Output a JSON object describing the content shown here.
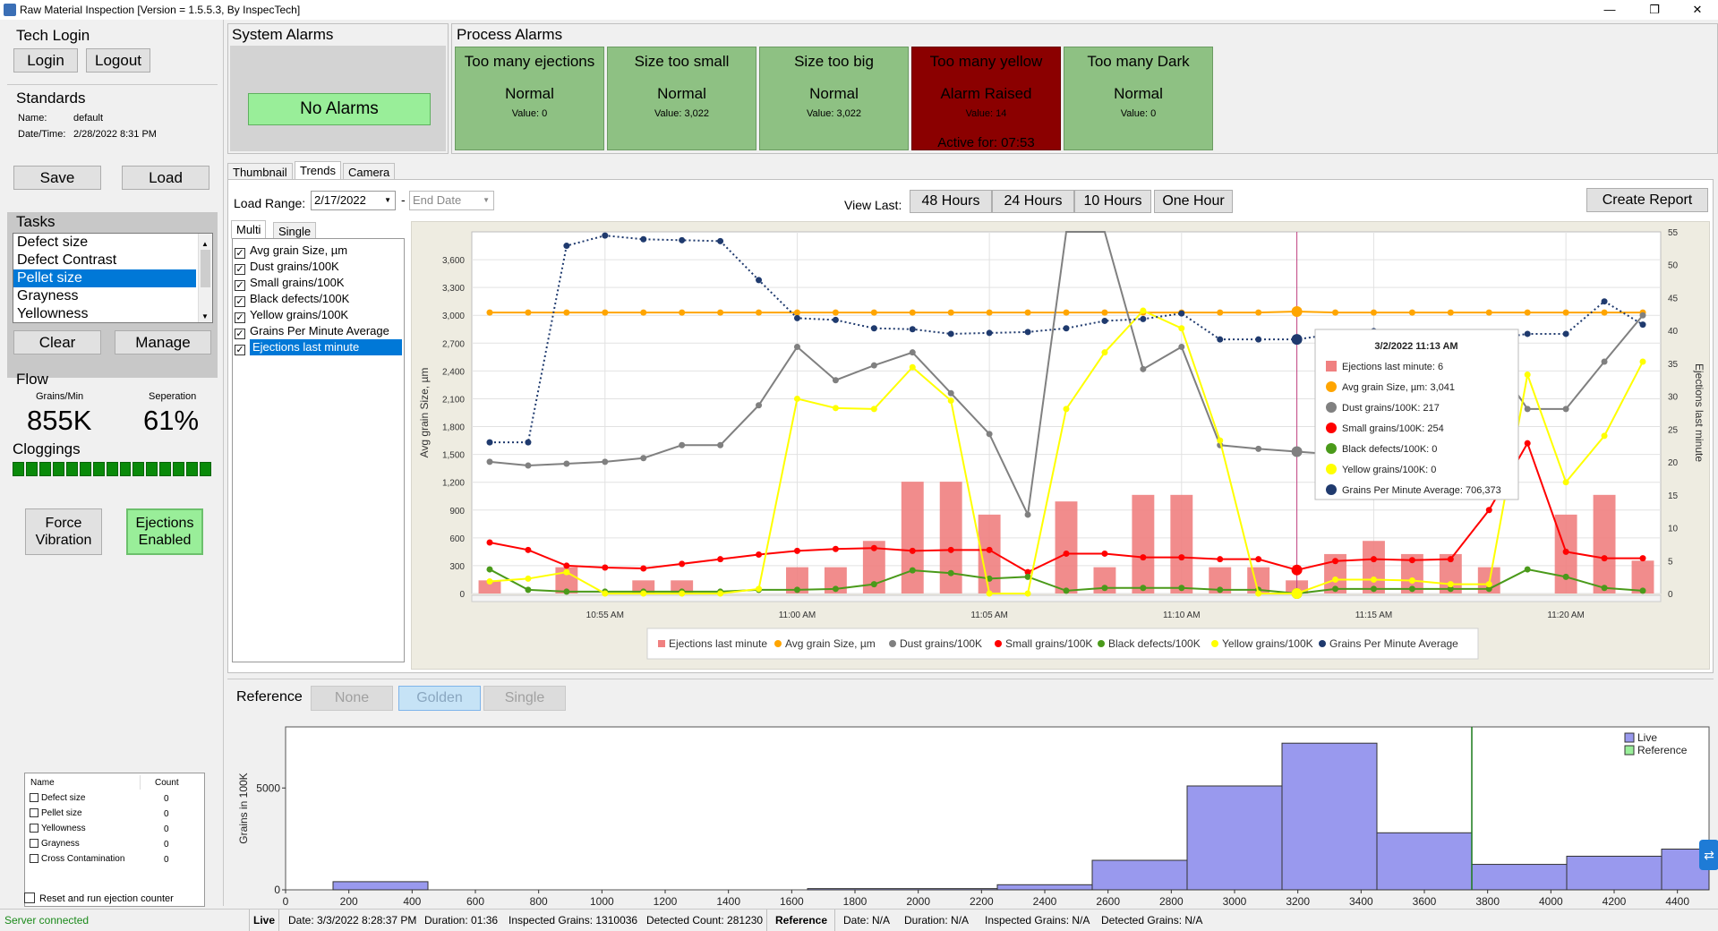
{
  "window": {
    "title": "Raw Material Inspection [Version = 1.5.5.3, By InspecTech]",
    "min": "—",
    "max": "❐",
    "close": "✕"
  },
  "tech_login": {
    "title": "Tech Login",
    "login": "Login",
    "logout": "Logout"
  },
  "standards": {
    "title": "Standards",
    "name_label": "Name:",
    "name_value": "default",
    "date_label": "Date/Time:",
    "date_value": "2/28/2022 8:31 PM",
    "save": "Save",
    "load": "Load"
  },
  "tasks": {
    "title": "Tasks",
    "items": [
      "Defect size",
      "Defect Contrast",
      "Pellet size",
      "Grayness",
      "Yellowness"
    ],
    "selected": 2,
    "clear": "Clear",
    "manage": "Manage"
  },
  "flow": {
    "title": "Flow",
    "grains_label": "Grains/Min",
    "grains_value": "855K",
    "sep_label": "Seperation",
    "sep_value": "61%",
    "cloggings": "Cloggings",
    "clog_segments": 15
  },
  "controls": {
    "force_vibration": "Force Vibration",
    "ejections_enabled": "Ejections Enabled"
  },
  "counts": {
    "col_name": "Name",
    "col_count": "Count",
    "rows": [
      {
        "name": "Defect size",
        "count": "0"
      },
      {
        "name": "Pellet size",
        "count": "0"
      },
      {
        "name": "Yellowness",
        "count": "0"
      },
      {
        "name": "Grayness",
        "count": "0"
      },
      {
        "name": "Cross Contamination",
        "count": "0"
      }
    ],
    "reset_label": "Reset and run ejection counter"
  },
  "system_alarms": {
    "title": "System Alarms",
    "status": "No Alarms"
  },
  "process_alarms": {
    "title": "Process Alarms",
    "items": [
      {
        "name": "Too many ejections",
        "state": "Normal",
        "value": "Value: 0",
        "active": ""
      },
      {
        "name": "Size too small",
        "state": "Normal",
        "value": "Value: 3,022",
        "active": ""
      },
      {
        "name": "Size too big",
        "state": "Normal",
        "value": "Value: 3,022",
        "active": ""
      },
      {
        "name": "Too many yellow",
        "state": "Alarm Raised",
        "value": "Value: 14",
        "active": "Active for: 07:53"
      },
      {
        "name": "Too many Dark",
        "state": "Normal",
        "value": "Value: 0",
        "active": ""
      }
    ]
  },
  "tabs": [
    "Thumbnail",
    "Trends",
    "Camera"
  ],
  "trends": {
    "load_range_label": "Load Range:",
    "start_date": "2/17/2022",
    "dash": "-",
    "end_date": "End Date",
    "view_last_label": "View Last:",
    "view_buttons": [
      "48 Hours",
      "24 Hours",
      "10 Hours",
      "One Hour"
    ],
    "create_report": "Create Report",
    "subtabs": [
      "Multi",
      "Single"
    ],
    "series_checks": [
      "Avg grain Size, µm",
      "Dust grains/100K",
      "Small grains/100K",
      "Black defects/100K",
      "Yellow grains/100K",
      "Grains Per Minute Average",
      "Ejections last minute"
    ],
    "tooltip": {
      "title": "3/2/2022 11:13 AM",
      "lines": [
        {
          "text": "Ejections last minute: 6",
          "color": "#f08080",
          "shape": "square"
        },
        {
          "text": "Avg grain Size, µm: 3,041",
          "color": "#ffa500",
          "shape": "circle"
        },
        {
          "text": "Dust grains/100K: 217",
          "color": "#808080",
          "shape": "circle"
        },
        {
          "text": "Small grains/100K: 254",
          "color": "#ff0000",
          "shape": "circle"
        },
        {
          "text": "Black defects/100K: 0",
          "color": "#4a9a1a",
          "shape": "circle"
        },
        {
          "text": "Yellow grains/100K: 0",
          "color": "#ffff00",
          "shape": "circle"
        },
        {
          "text": "Grains Per Minute Average: 706,373",
          "color": "#1f3a6e",
          "shape": "circle"
        }
      ]
    }
  },
  "reference": {
    "label": "Reference",
    "buttons": [
      "None",
      "Golden",
      "Single"
    ]
  },
  "statusbar": {
    "server": "Server connected",
    "live_label": "Live",
    "date": "Date: 3/3/2022 8:28:37 PM",
    "duration": "Duration: 01:36",
    "inspected": "Inspected Grains: 1310036",
    "detected": "Detected Count: 281230",
    "ref_label": "Reference",
    "ref_date": "Date: N/A",
    "ref_duration": "Duration: N/A",
    "ref_inspected": "Inspected Grains: N/A",
    "ref_detected": "Detected Grains: N/A"
  },
  "chart_data": [
    {
      "type": "line",
      "x": [
        "10:52",
        "10:53",
        "10:54",
        "10:55",
        "10:56",
        "10:57",
        "10:58",
        "10:59",
        "11:00",
        "11:01",
        "11:02",
        "11:03",
        "11:04",
        "11:05",
        "11:06",
        "11:07",
        "11:08",
        "11:09",
        "11:10",
        "11:11",
        "11:12",
        "11:13",
        "11:14",
        "11:15",
        "11:16",
        "11:17",
        "11:18",
        "11:19",
        "11:20",
        "11:21",
        "11:22"
      ],
      "xtick_labels": [
        "10:55 AM",
        "11:00 AM",
        "11:05 AM",
        "11:10 AM",
        "11:15 AM",
        "11:20 AM"
      ],
      "ylabel": "Avg grain Size, µm",
      "y2label": "Ejections last minute",
      "ylim": [
        0,
        3900
      ],
      "y2lim": [
        0,
        55
      ],
      "yticks": [
        "0",
        "300",
        "600",
        "900",
        "1,200",
        "1,500",
        "1,800",
        "2,100",
        "2,400",
        "2,700",
        "3,000",
        "3,300",
        "3,600"
      ],
      "y2ticks": [
        "0",
        "5",
        "10",
        "15",
        "20",
        "25",
        "30",
        "35",
        "40",
        "45",
        "50",
        "55"
      ],
      "legend": [
        "Ejections last minute",
        "Avg grain Size, µm",
        "Dust grains/100K",
        "Small grains/100K",
        "Black defects/100K",
        "Yellow grains/100K",
        "Grains Per Minute Average"
      ],
      "legend_position": "bottom",
      "series": [
        {
          "name": "Ejections last minute",
          "kind": "bar",
          "axis": "y2",
          "color": "#f08080",
          "values": [
            2,
            0,
            4,
            0,
            2,
            2,
            0,
            0,
            4,
            4,
            8,
            17,
            17,
            12,
            0,
            14,
            4,
            15,
            15,
            4,
            4,
            2,
            6,
            8,
            6,
            6,
            4,
            0,
            12,
            15,
            5
          ]
        },
        {
          "name": "Avg grain Size, µm",
          "kind": "line",
          "axis": "y",
          "color": "#ffa500",
          "values": [
            3030,
            3030,
            3030,
            3030,
            3030,
            3030,
            3030,
            3030,
            3030,
            3030,
            3030,
            3030,
            3030,
            3030,
            3030,
            3030,
            3030,
            3030,
            3030,
            3030,
            3030,
            3041,
            3030,
            3030,
            3030,
            3030,
            3030,
            3030,
            3030,
            3030,
            3030
          ]
        },
        {
          "name": "Dust grains/100K",
          "kind": "line",
          "axis": "y",
          "color": "#808080",
          "values": [
            1420,
            1380,
            1400,
            1420,
            1460,
            1600,
            1600,
            2030,
            2660,
            2300,
            2460,
            2600,
            2160,
            1720,
            850,
            5000,
            5000,
            2420,
            2660,
            1600,
            1560,
            1530,
            1500,
            1500,
            1550,
            2500,
            2600,
            1990,
            1990,
            2500,
            3000
          ]
        },
        {
          "name": "Small grains/100K",
          "kind": "line",
          "axis": "y",
          "color": "#ff0000",
          "values": [
            550,
            470,
            300,
            280,
            270,
            320,
            370,
            420,
            460,
            480,
            490,
            460,
            470,
            470,
            230,
            430,
            430,
            390,
            390,
            370,
            370,
            254,
            350,
            370,
            360,
            370,
            900,
            1620,
            450,
            380,
            380
          ]
        },
        {
          "name": "Black defects/100K",
          "kind": "line",
          "axis": "y",
          "color": "#4a9a1a",
          "values": [
            260,
            40,
            20,
            20,
            20,
            20,
            20,
            40,
            40,
            50,
            100,
            250,
            220,
            160,
            180,
            30,
            60,
            60,
            60,
            40,
            40,
            0,
            50,
            50,
            50,
            50,
            50,
            260,
            180,
            60,
            30
          ]
        },
        {
          "name": "Yellow grains/100K",
          "kind": "line",
          "axis": "y",
          "color": "#ffff00",
          "values": [
            130,
            160,
            230,
            0,
            0,
            0,
            0,
            50,
            2100,
            2000,
            1990,
            2440,
            2080,
            0,
            0,
            1990,
            2600,
            3050,
            2860,
            1650,
            0,
            0,
            150,
            150,
            140,
            100,
            100,
            2360,
            1200,
            1700,
            2500
          ]
        },
        {
          "name": "Grains Per Minute Average",
          "kind": "line",
          "axis": "y",
          "color": "#1f3a6e",
          "dotted": true,
          "values": [
            1630,
            1630,
            3750,
            3860,
            3820,
            3810,
            3800,
            3380,
            2970,
            2950,
            2860,
            2850,
            2800,
            2810,
            2820,
            2860,
            2940,
            2960,
            3020,
            2740,
            2740,
            2740,
            2800,
            2830,
            2800,
            2800,
            2740,
            2800,
            2800,
            3150,
            2900
          ]
        }
      ]
    },
    {
      "type": "bar",
      "ylabel": "Grains in 100K",
      "xlim": [
        0,
        4500
      ],
      "ylim": [
        0,
        8000
      ],
      "xticks": [
        "0",
        "200",
        "400",
        "600",
        "800",
        "1000",
        "1200",
        "1400",
        "1600",
        "1800",
        "2000",
        "2200",
        "2400",
        "2600",
        "2800",
        "3000",
        "3200",
        "3400",
        "3600",
        "3800",
        "4000",
        "4200",
        "4400"
      ],
      "yticks": [
        "0",
        "5000"
      ],
      "legend": [
        "Live",
        "Reference"
      ],
      "legend_colors": [
        "#9999ee",
        "#99ee99"
      ],
      "legend_position": "top-right",
      "bins": [
        {
          "x0": 150,
          "x1": 450,
          "value": 400
        },
        {
          "x0": 1650,
          "x1": 2250,
          "value": 60
        },
        {
          "x0": 2250,
          "x1": 2550,
          "value": 250
        },
        {
          "x0": 2550,
          "x1": 2850,
          "value": 1450
        },
        {
          "x0": 2850,
          "x1": 3150,
          "value": 5100
        },
        {
          "x0": 3150,
          "x1": 3450,
          "value": 7200
        },
        {
          "x0": 3450,
          "x1": 3750,
          "value": 2800
        },
        {
          "x0": 3750,
          "x1": 4050,
          "value": 1250
        },
        {
          "x0": 4050,
          "x1": 4350,
          "value": 1650
        },
        {
          "x0": 4350,
          "x1": 4500,
          "value": 2000
        }
      ],
      "reference_line_x": 3750
    }
  ]
}
